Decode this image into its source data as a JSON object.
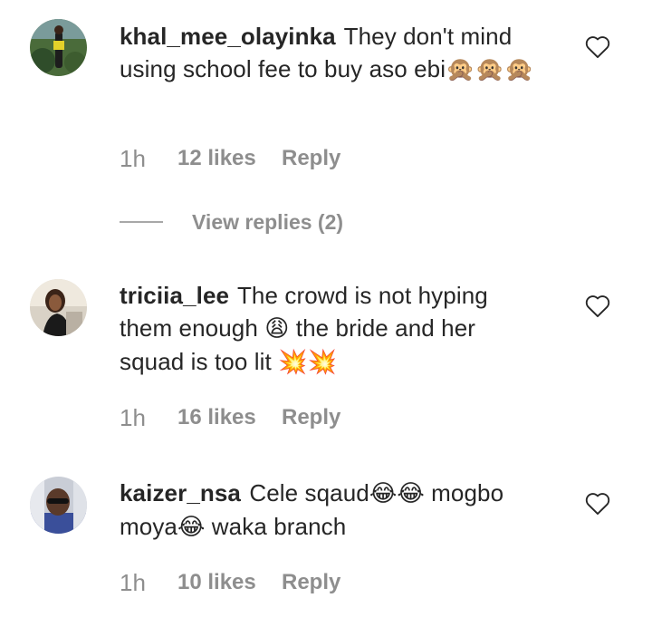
{
  "comments": [
    {
      "username": "khal_mee_olayinka",
      "text": "They don't mind using school fee to buy aso ebi",
      "emoji": "🙊🙊🙊",
      "time": "1h",
      "likes": "12 likes",
      "reply": "Reply",
      "avatar_icon": "avatar-photo",
      "view_replies": "View replies (2)"
    },
    {
      "username": "triciia_lee",
      "text_1": "The crowd is not hyping them enough",
      "emoji_1": "😩",
      "text_2": "the bride and her squad is too lit",
      "emoji_2": "💥💥",
      "time": "1h",
      "likes": "16 likes",
      "reply": "Reply",
      "avatar_icon": "avatar-photo"
    },
    {
      "username": "kaizer_nsa",
      "text_1": "Cele sqaud",
      "emoji_1": "😂😂",
      "text_2": "mogbo moya",
      "emoji_2": "😂",
      "text_3": "waka branch",
      "time": "1h",
      "likes": "10 likes",
      "reply": "Reply",
      "avatar_icon": "avatar-photo"
    }
  ],
  "icons": {
    "like": "heart-outline-icon"
  },
  "colors": {
    "text": "#262626",
    "meta": "#8e8e8e",
    "heart_stroke": "#262626"
  }
}
